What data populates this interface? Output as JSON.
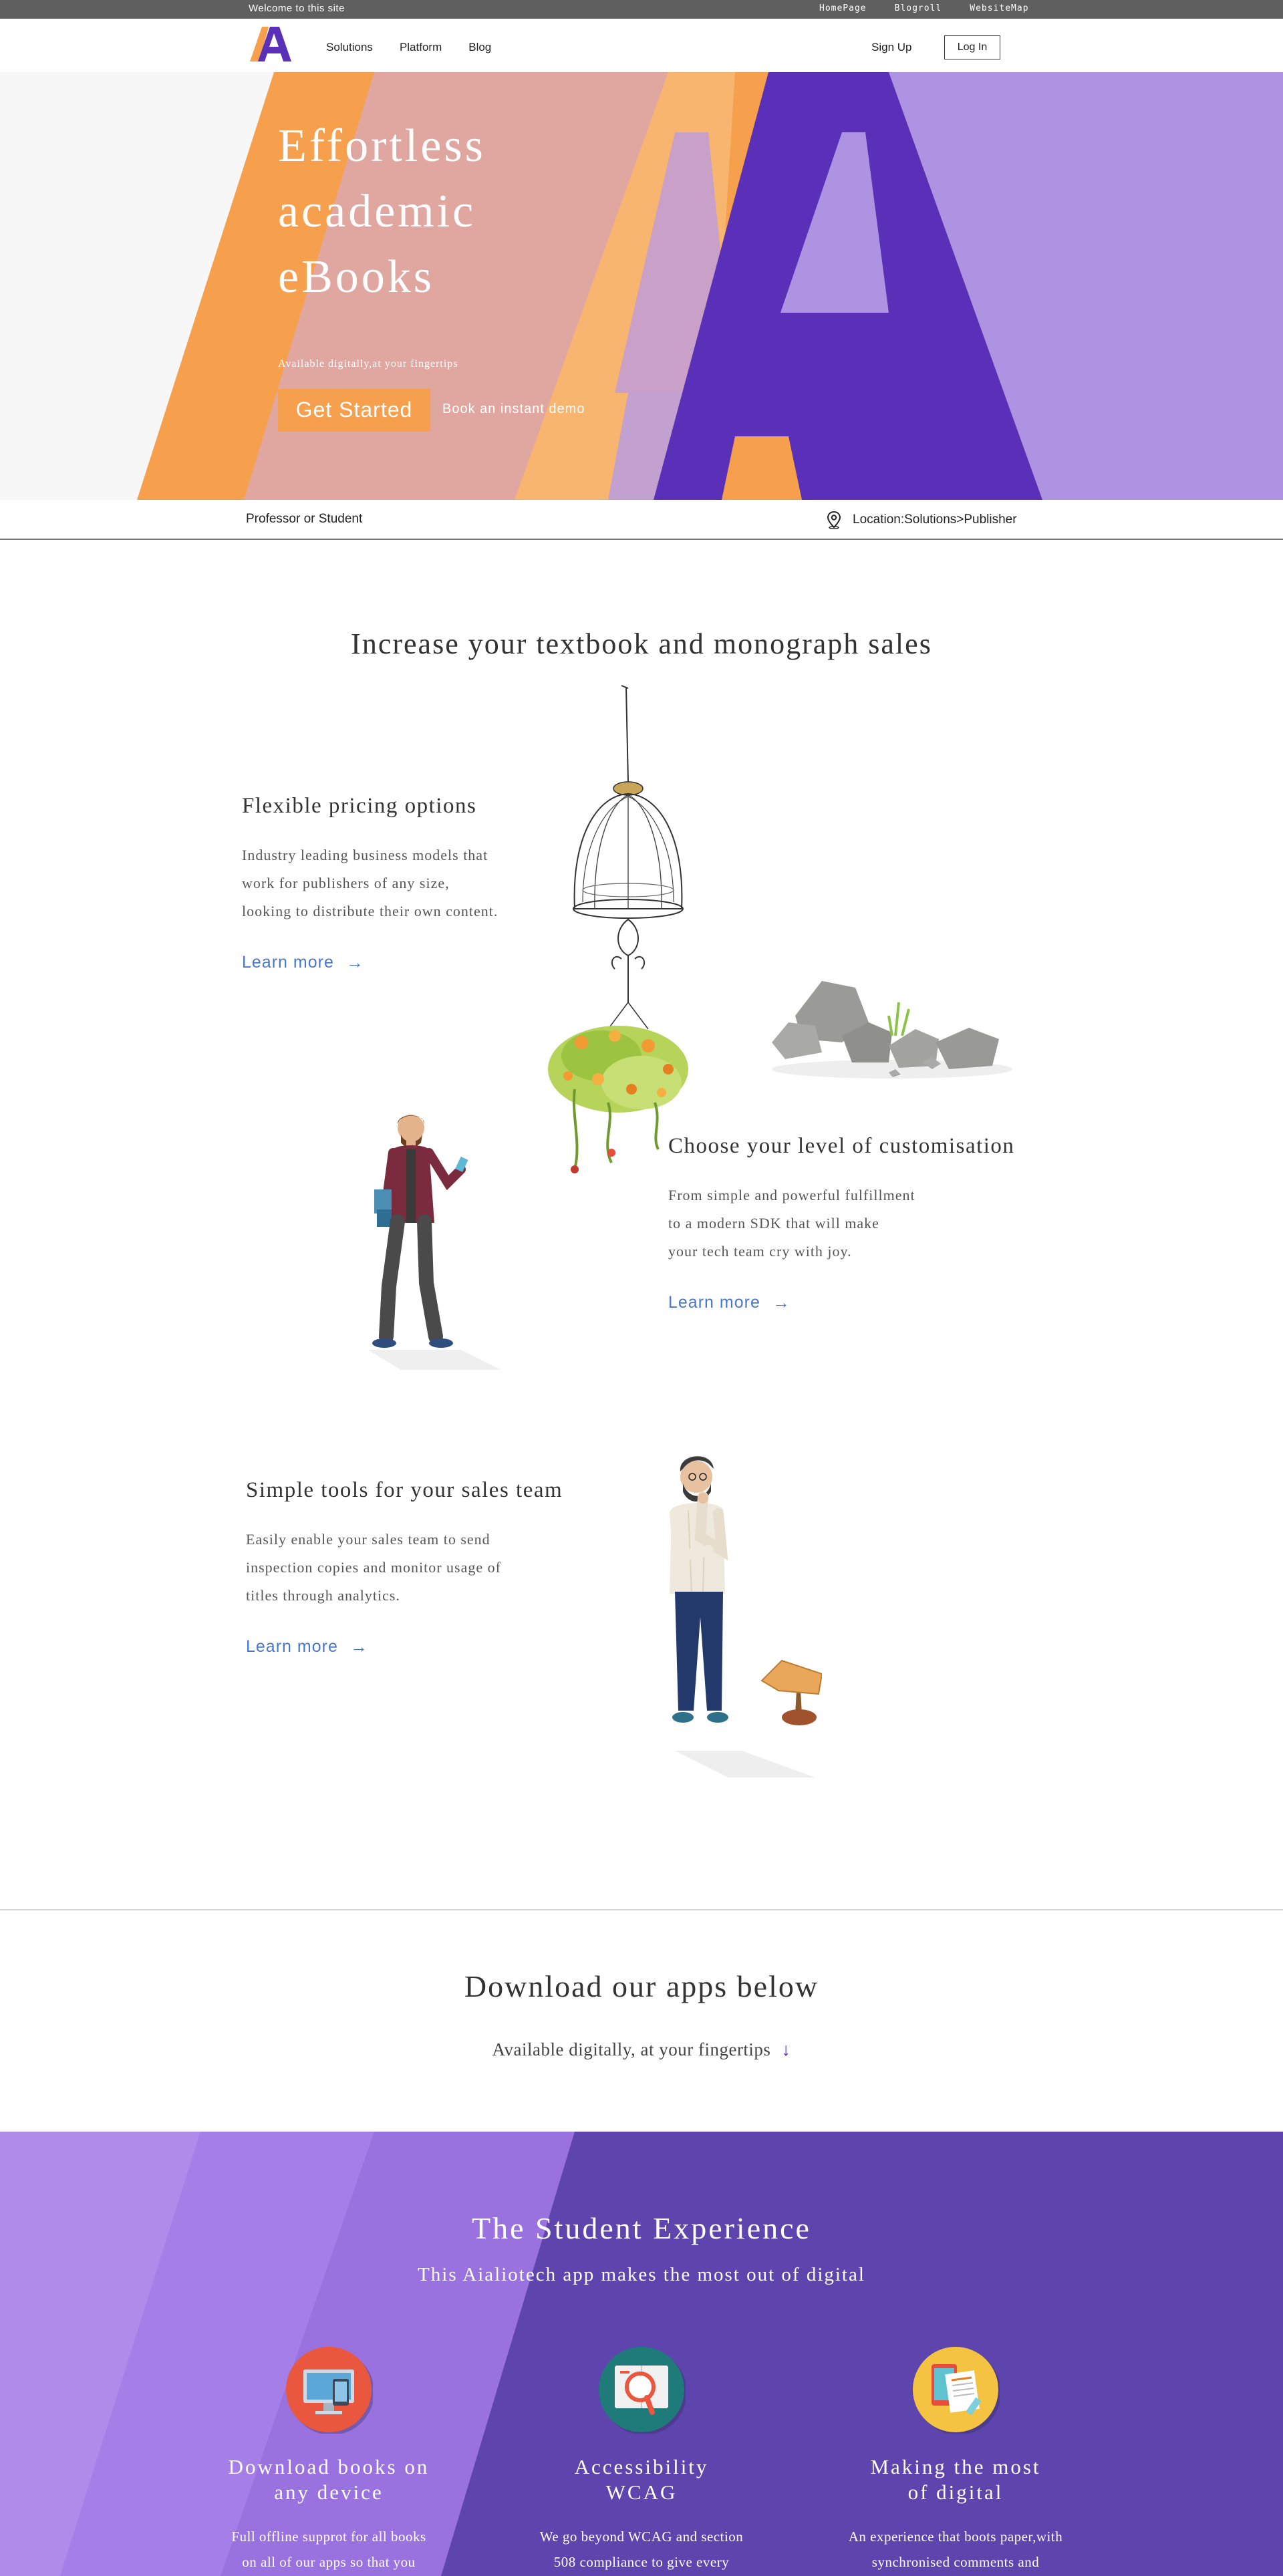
{
  "topbar": {
    "welcome": "Welcome to this site",
    "links": [
      "HomePage",
      "Blogroll",
      "WebsiteMap"
    ]
  },
  "nav": {
    "links": [
      "Solutions",
      "Platform",
      "Blog"
    ],
    "signup": "Sign Up",
    "login": "Log In"
  },
  "hero": {
    "title_lines": [
      "Effortless",
      "academic",
      "eBooks"
    ],
    "subtitle": "Available digitally,at your fingertips",
    "cta": "Get Started",
    "demo": "Book an instant demo"
  },
  "subbar": {
    "role": "Professor or Student",
    "location": "Location:Solutions>Publisher"
  },
  "features": {
    "heading": "Increase your textbook and monograph sales",
    "items": [
      {
        "title": "Flexible pricing options",
        "lines": [
          "Industry leading business models that",
          "work for publishers of any size,",
          "looking to distribute their own content."
        ],
        "link": "Learn more"
      },
      {
        "title": "Choose your level of customisation",
        "lines": [
          "From simple and powerful fulfillment",
          "to a modern SDK that will make",
          "your tech team cry with joy."
        ],
        "link": "Learn more"
      },
      {
        "title": "Simple tools for your sales team",
        "lines": [
          "Easily enable your sales team to send",
          "inspection copies and monitor usage of",
          "titles through analytics."
        ],
        "link": "Learn more"
      }
    ]
  },
  "download": {
    "heading": "Download our apps below",
    "subtitle": "Available digitally, at your fingertips",
    "arrow": "↓"
  },
  "student": {
    "title": "The Student Experience",
    "subtitle": "This Aialiotech app makes the most out of digital",
    "cards": [
      {
        "title_lines": [
          "Download books on",
          "any device"
        ],
        "text_lines": [
          "Full offline supprot for all books",
          "on all of our apps so that you"
        ],
        "icon": "devices-icon"
      },
      {
        "title_lines": [
          "Accessibility",
          "WCAG"
        ],
        "text_lines": [
          "We go beyond WCAG and section",
          "508 compliance to give every"
        ],
        "icon": "magnifier-book-icon"
      },
      {
        "title_lines": [
          "Making the most",
          "of digital"
        ],
        "text_lines": [
          "An experience that boots paper,with",
          "synchronised comments and"
        ],
        "icon": "tablet-document-icon"
      }
    ]
  },
  "colors": {
    "brand_purple": "#5b30b8",
    "brand_orange": "#f6a04d",
    "link_blue": "#4a77c9",
    "purple_section": "#5e44ad"
  }
}
